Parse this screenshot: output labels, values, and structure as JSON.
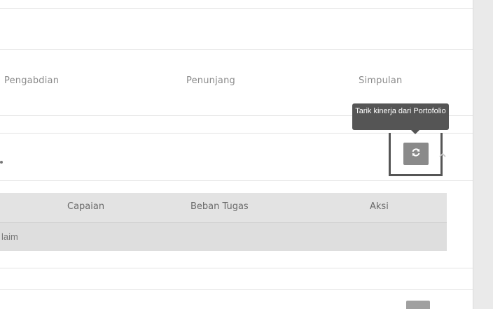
{
  "tabs": [
    {
      "label": "Pengabdian"
    },
    {
      "label": "Penunjang"
    },
    {
      "label": "Simpulan"
    }
  ],
  "tooltip": {
    "text": "Tarik kinerja dari Portofolio"
  },
  "actions": {
    "refresh_icon": "refresh-icon",
    "collapse_icon": "chevron-up-icon"
  },
  "table": {
    "headers": [
      "Capaian",
      "Beban Tugas",
      "Aksi"
    ],
    "rows": [
      {
        "cell_text": "laim"
      }
    ]
  },
  "colors": {
    "tooltip_bg": "#555555",
    "button_bg": "#8a8a8a",
    "table_header_bg": "#e3e3e3",
    "table_row_bg": "#dedede"
  }
}
